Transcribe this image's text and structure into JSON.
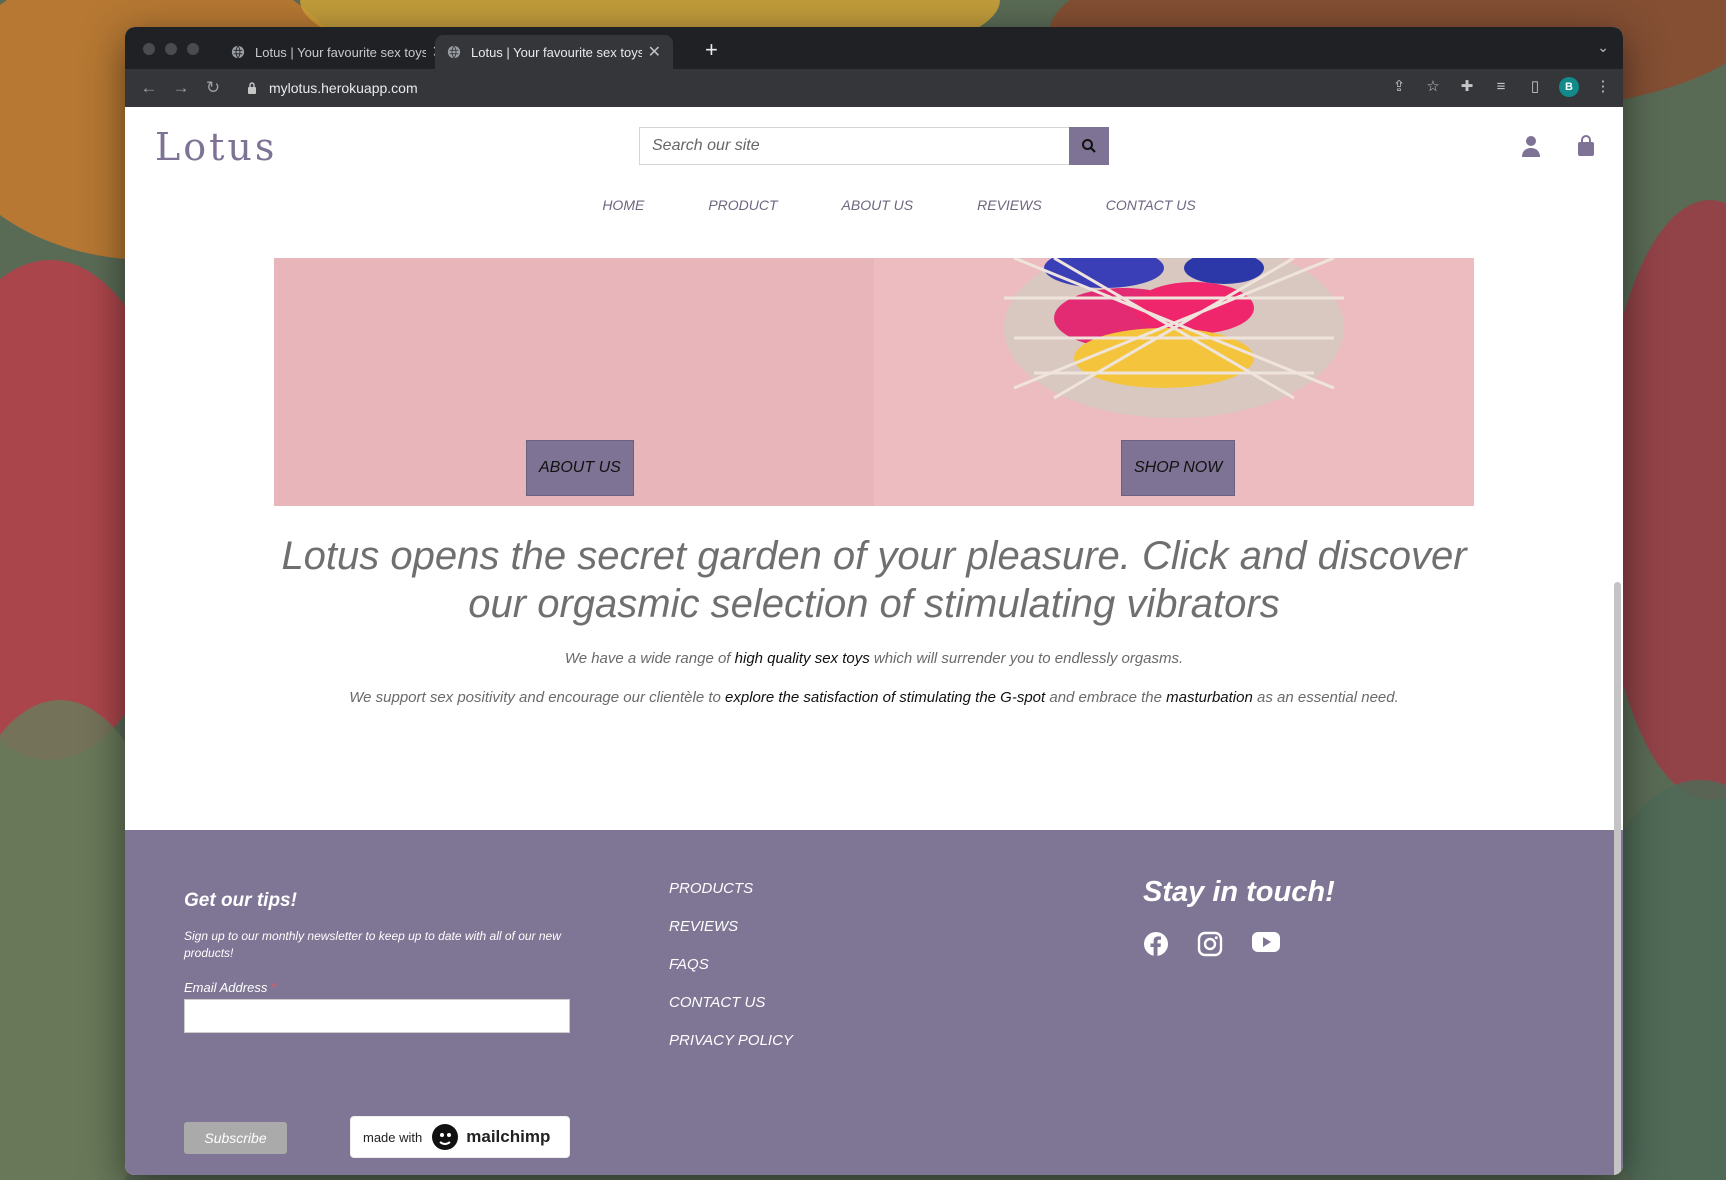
{
  "browser": {
    "tabs": [
      {
        "title": "Lotus | Your favourite sex toys"
      },
      {
        "title": "Lotus | Your favourite sex toys"
      }
    ],
    "url": "mylotus.herokuapp.com",
    "profile_initial": "B"
  },
  "header": {
    "logo": "Lotus",
    "search_placeholder": "Search our site"
  },
  "nav": [
    "HOME",
    "PRODUCT",
    "ABOUT US",
    "REVIEWS",
    "CONTACT US"
  ],
  "hero": {
    "left_button": "ABOUT US",
    "right_button": "SHOP NOW"
  },
  "intro": {
    "headline": "Lotus opens the secret garden of your pleasure. Click and discover our orgasmic selection of stimulating vibrators",
    "p1_a": "We have a wide range of ",
    "p1_link": "high quality sex toys",
    "p1_b": " which will surrender you to endlessly orgasms.",
    "p2_a": "We support sex positivity and encourage our clientèle to ",
    "p2_link1": "explore the satisfaction of stimulating the G-spot",
    "p2_b": " and embrace the ",
    "p2_link2": "masturbation",
    "p2_c": " as an essential need."
  },
  "footer": {
    "newsletter_title": "Get our tips!",
    "newsletter_note": "Sign up to our monthly newsletter to keep up to date with all of our new products!",
    "email_label": "Email Address",
    "required_mark": "*",
    "subscribe": "Subscribe",
    "mailchimp_prefix": "made with",
    "mailchimp_brand": "mailchimp",
    "links": [
      "PRODUCTS",
      "REVIEWS",
      "FAQS",
      "CONTACT US",
      "PRIVACY POLICY"
    ],
    "social_title": "Stay in touch!",
    "social_icons": [
      "facebook-icon",
      "instagram-icon",
      "youtube-icon"
    ]
  },
  "colors": {
    "brand": "#7e7394",
    "footer_bg": "#7f7594",
    "hero_bg": "#e8b6ba"
  }
}
